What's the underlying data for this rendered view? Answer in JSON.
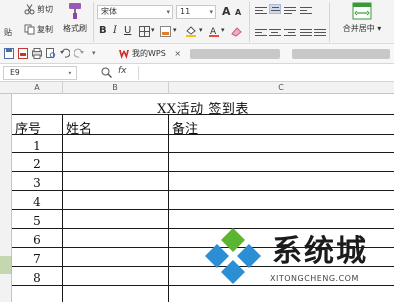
{
  "ribbon": {
    "cut_label": "剪切",
    "copy_label": "复制",
    "paste_label": "贴",
    "format_painter_label": "格式刷",
    "font_name": "宋体",
    "font_size": "11",
    "bold": "B",
    "italic": "I",
    "underline": "U",
    "grow_font": "A",
    "shrink_font": "A",
    "merge_center_label": "合并居中"
  },
  "quick_access": {
    "tab_label": "我的WPS",
    "close": "×"
  },
  "formula_bar": {
    "name_box": "E9",
    "fx_label": "fx"
  },
  "columns": [
    "A",
    "B",
    "C"
  ],
  "sheet": {
    "title": "XX活动  签到表",
    "headers": [
      "序号",
      "姓名",
      "备注"
    ],
    "rows": [
      "1",
      "2",
      "3",
      "4",
      "5",
      "6",
      "7",
      "8"
    ]
  },
  "watermark": {
    "brand": "系统城",
    "url": "XITONGCHENG.COM",
    "colors": {
      "blue": "#2b8fd6",
      "green": "#5cb531"
    }
  }
}
